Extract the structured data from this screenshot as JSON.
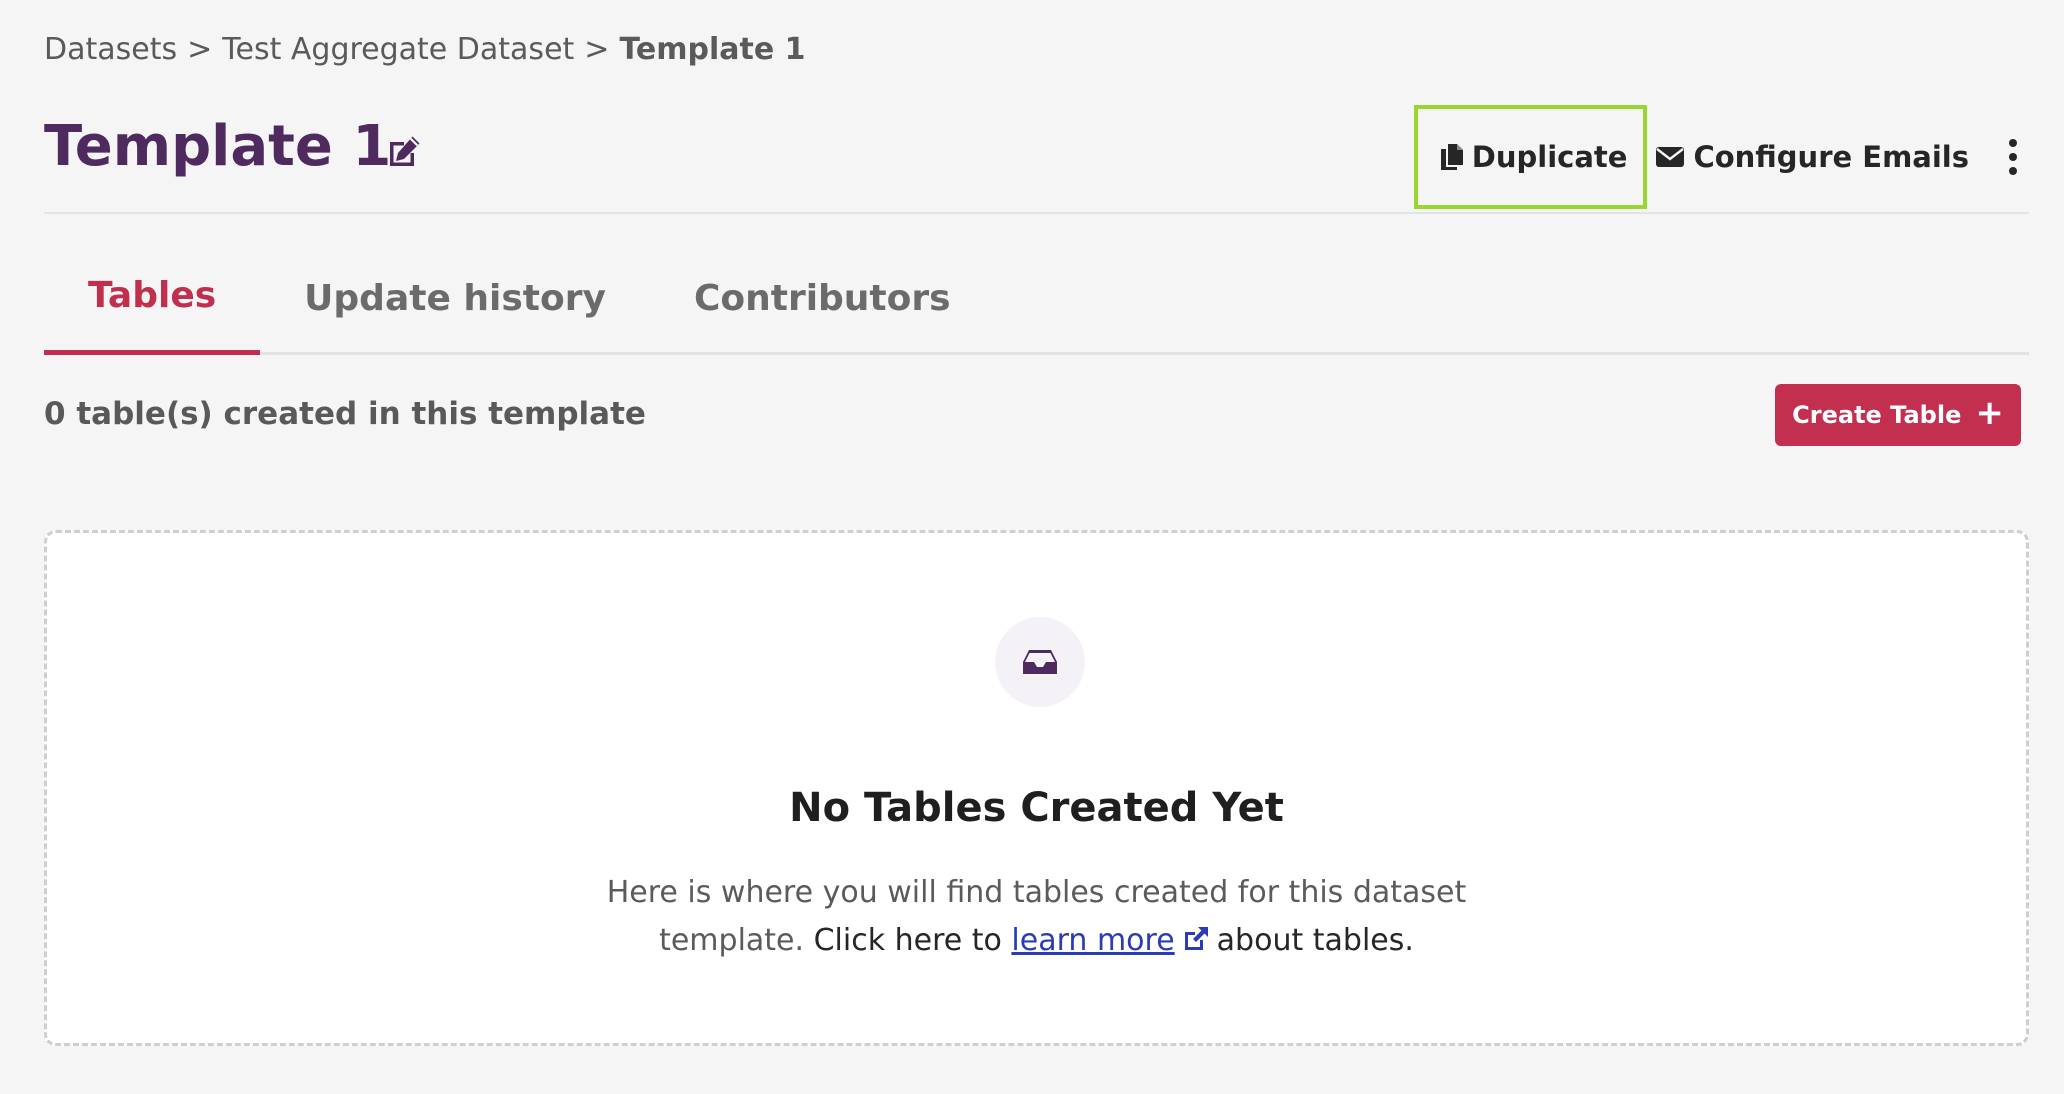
{
  "breadcrumb": {
    "items": [
      "Datasets",
      "Test Aggregate Dataset"
    ],
    "separator": ">",
    "current": "Template 1"
  },
  "header": {
    "title": "Template 1",
    "actions": {
      "duplicate_label": "Duplicate",
      "configure_emails_label": "Configure Emails"
    }
  },
  "tabs": [
    {
      "label": "Tables",
      "active": true
    },
    {
      "label": "Update history",
      "active": false
    },
    {
      "label": "Contributors",
      "active": false
    }
  ],
  "tables": {
    "count_text": "0 table(s) created in this template",
    "create_button_label": "Create Table",
    "create_button_icon": "plus-icon"
  },
  "empty_state": {
    "icon": "inbox-icon",
    "title": "No Tables Created Yet",
    "desc_line1": "Here is where you will find tables created for this dataset",
    "desc_line2_a": "template.",
    "desc_line2_b": "Click here to",
    "link_text": "learn more",
    "desc_line2_c": "about tables."
  },
  "colors": {
    "title": "#4f2a5e",
    "accent": "#c0304e",
    "highlight": "#9ad630",
    "link": "#2a3bb8"
  }
}
